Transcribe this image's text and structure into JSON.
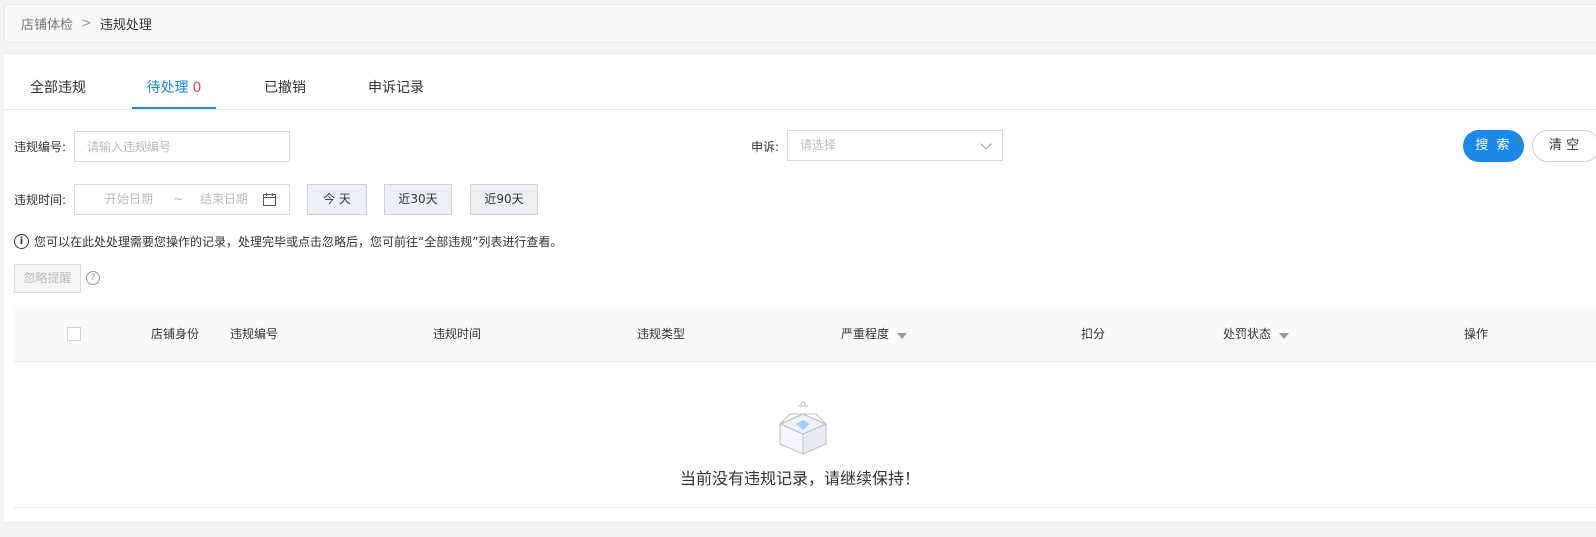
{
  "breadcrumb": {
    "parent": "店铺体检",
    "separator": ">",
    "current": "违规处理"
  },
  "tabs": [
    {
      "label": "全部违规"
    },
    {
      "label": "待处理",
      "count": "0"
    },
    {
      "label": "已撤销"
    },
    {
      "label": "申诉记录"
    }
  ],
  "filters": {
    "violation_no_label": "违规编号:",
    "violation_no_placeholder": "请输入违规编号",
    "appeal_label": "申诉:",
    "appeal_placeholder": "请选择",
    "time_label": "违规时间:",
    "start_date_placeholder": "开始日期",
    "date_separator": "~",
    "end_date_placeholder": "结束日期",
    "today": "今 天",
    "last30": "近30天",
    "last90": "近90天"
  },
  "actions": {
    "search": "搜 索",
    "clear": "清 空"
  },
  "notice": "您可以在此处处理需要您操作的记录，处理完毕或点击忽略后，您可前往“全部违规”列表进行查看。",
  "ignore_button": "忽略提醒",
  "table": {
    "columns": [
      "店铺身份",
      "违规编号",
      "违规时间",
      "违规类型",
      "严重程度",
      "扣分",
      "处罚状态",
      "操作"
    ]
  },
  "empty": {
    "message": "当前没有违规记录，请继续保持！"
  },
  "colors": {
    "primary": "#1d88e8",
    "count": "#e84a4a"
  }
}
